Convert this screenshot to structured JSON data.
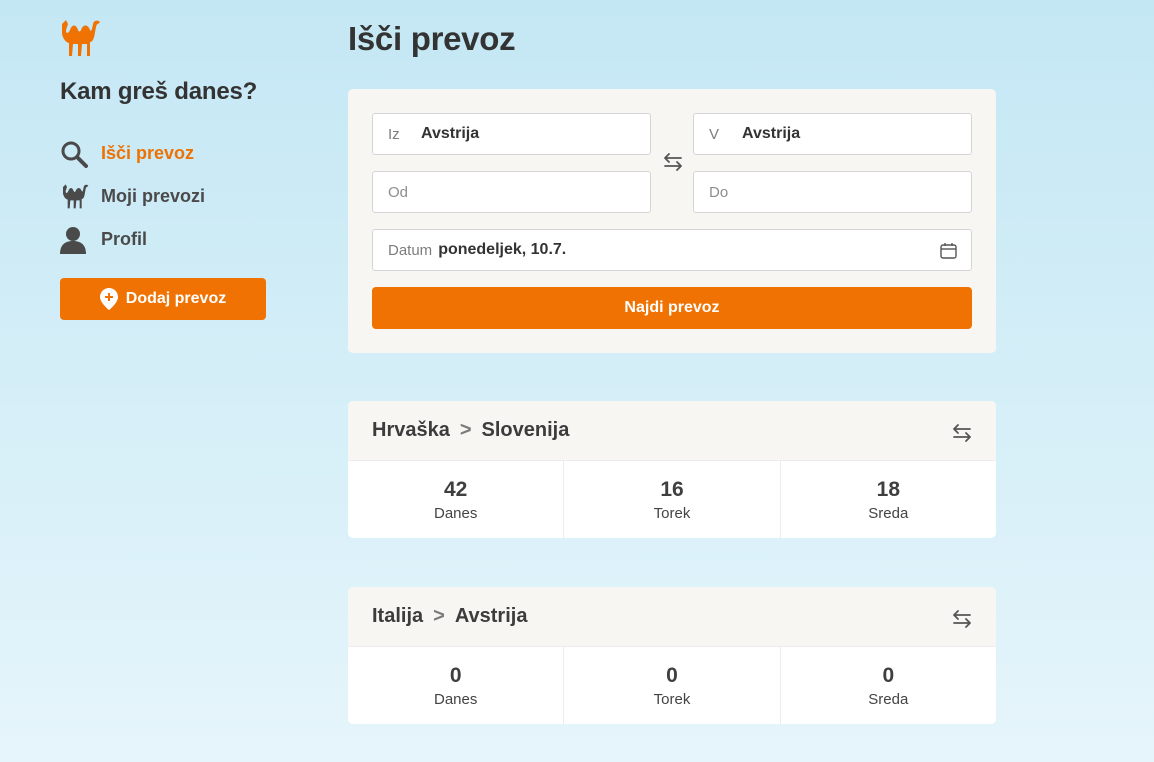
{
  "brand": {
    "accent": "#ef7203",
    "logo_icon": "camel-icon"
  },
  "sidebar": {
    "tagline": "Kam greš danes?",
    "items": [
      {
        "label": "Išči prevoz",
        "icon": "search-icon",
        "active": true
      },
      {
        "label": "Moji prevozi",
        "icon": "camel-icon",
        "active": false
      },
      {
        "label": "Profil",
        "icon": "user-icon",
        "active": false
      }
    ],
    "add_button": {
      "label": "Dodaj prevoz",
      "icon": "location-plus-icon"
    }
  },
  "main": {
    "title": "Išči prevoz",
    "search": {
      "from_country": {
        "label": "Iz",
        "value": "Avstrija"
      },
      "to_country": {
        "label": "V",
        "value": "Avstrija"
      },
      "from_city": {
        "placeholder": "Od"
      },
      "to_city": {
        "placeholder": "Do"
      },
      "date": {
        "label": "Datum",
        "value": "ponedeljek, 10.7.",
        "icon": "calendar-icon"
      },
      "submit_label": "Najdi prevoz",
      "swap_icon": "swap-arrows-icon"
    },
    "routes": [
      {
        "from": "Hrvaška",
        "to": "Slovenija",
        "separator": ">",
        "days": [
          {
            "count": "42",
            "name": "Danes"
          },
          {
            "count": "16",
            "name": "Torek"
          },
          {
            "count": "18",
            "name": "Sreda"
          }
        ]
      },
      {
        "from": "Italija",
        "to": "Avstrija",
        "separator": ">",
        "days": [
          {
            "count": "0",
            "name": "Danes"
          },
          {
            "count": "0",
            "name": "Torek"
          },
          {
            "count": "0",
            "name": "Sreda"
          }
        ]
      }
    ]
  }
}
